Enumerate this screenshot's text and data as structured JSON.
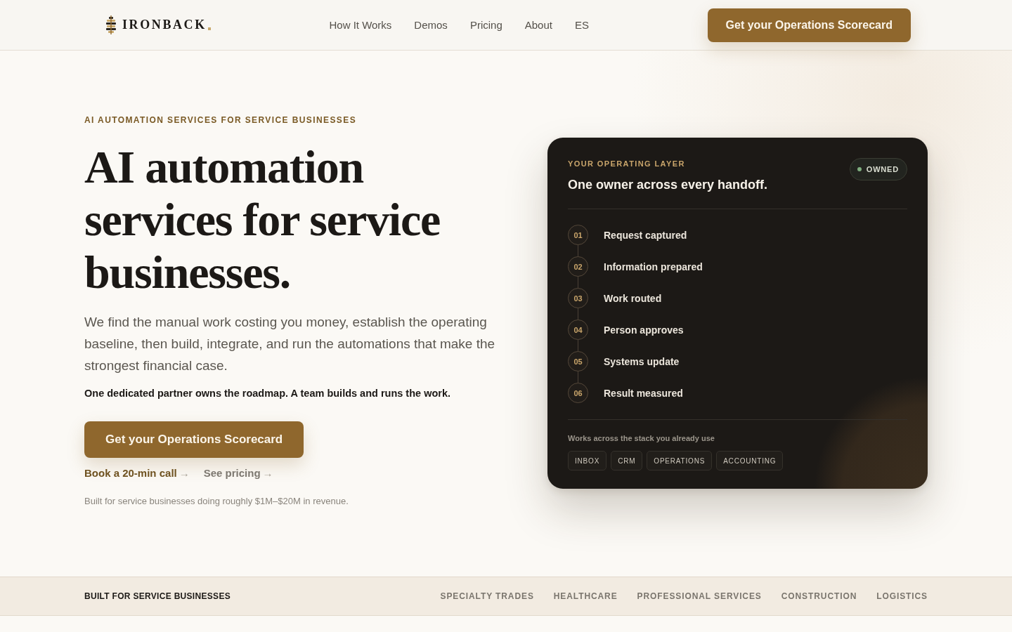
{
  "header": {
    "logo": {
      "text": "IRONBACK"
    },
    "nav": [
      {
        "label": "How It Works"
      },
      {
        "label": "Demos"
      },
      {
        "label": "Pricing"
      },
      {
        "label": "About"
      },
      {
        "label": "ES"
      }
    ],
    "cta": "Get your Operations Scorecard"
  },
  "hero": {
    "eyebrow": "AI AUTOMATION SERVICES FOR SERVICE BUSINESSES",
    "title": "AI automation services for service businesses.",
    "description": "We find the manual work costing you money, establish the operating baseline, then build, integrate, and run the automations that make the strongest financial case.",
    "emphasis": "One dedicated partner owns the roadmap. A team builds and runs the work.",
    "cta": "Get your Operations Scorecard",
    "links": [
      {
        "label": "Book a 20-min call",
        "arrow": "→",
        "kind": "primary"
      },
      {
        "label": "See pricing",
        "arrow": "→",
        "kind": "secondary"
      }
    ],
    "note": "Built for service businesses doing roughly $1M–$20M in revenue."
  },
  "card": {
    "eyebrow": "YOUR OPERATING LAYER",
    "title": "One owner across every handoff.",
    "badge": {
      "label": "OWNED",
      "color": "#7fae7f"
    },
    "steps": [
      {
        "number": "01",
        "label": "Request captured"
      },
      {
        "number": "02",
        "label": "Information prepared"
      },
      {
        "number": "03",
        "label": "Work routed"
      },
      {
        "number": "04",
        "label": "Person approves"
      },
      {
        "number": "05",
        "label": "Systems update"
      },
      {
        "number": "06",
        "label": "Result measured"
      }
    ],
    "footer": "Works across the stack you already use",
    "tags": [
      "INBOX",
      "CRM",
      "OPERATIONS",
      "ACCOUNTING"
    ]
  },
  "industries": {
    "label": "BUILT FOR SERVICE BUSINESSES",
    "items": [
      "SPECIALTY TRADES",
      "HEALTHCARE",
      "PROFESSIONAL SERVICES",
      "CONSTRUCTION",
      "LOGISTICS"
    ]
  }
}
